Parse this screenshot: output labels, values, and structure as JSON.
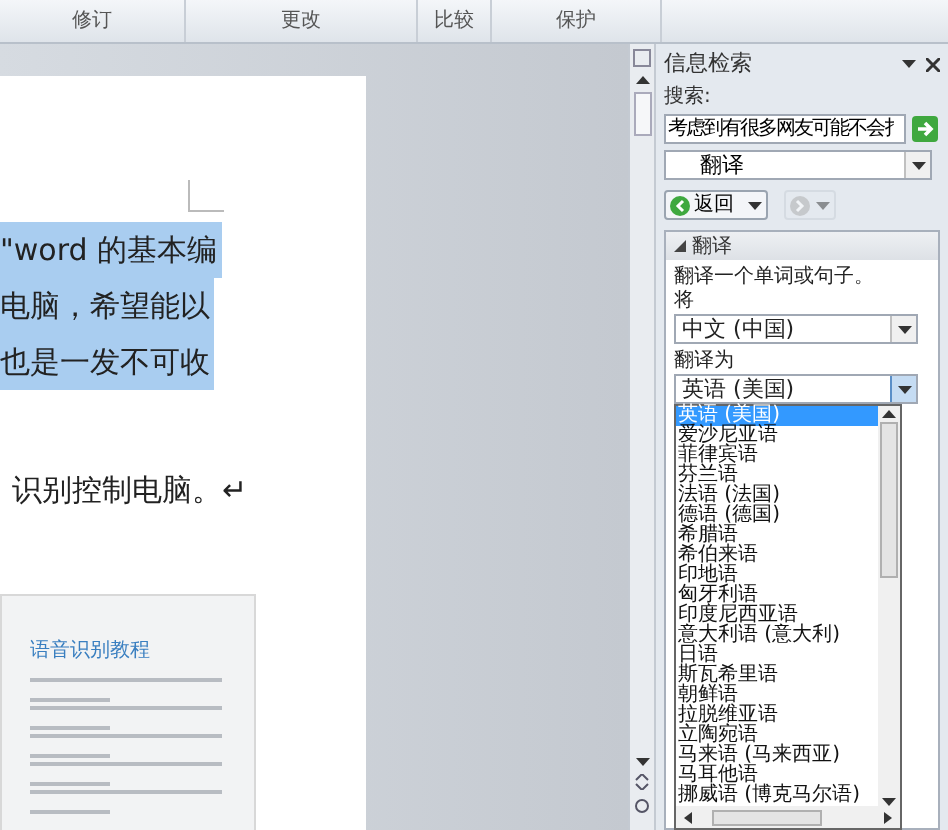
{
  "ribbon_groups": [
    "修订",
    "更改",
    "比较",
    "保护"
  ],
  "document": {
    "paragraphs": [
      {
        "text": "\"word 的基本编",
        "selected": true
      },
      {
        "text": "电脑，希望能以",
        "selected": true
      },
      {
        "text": "也是一发不可收",
        "selected": true
      },
      {
        "text": "识别控制电脑。↵",
        "selected": false
      }
    ],
    "thumbnail": {
      "title": "语音识别教程"
    }
  },
  "pane": {
    "title": "信息检索",
    "search_label": "搜索:",
    "search_value": "考虑到有很多网友可能不会扌",
    "service": "翻译",
    "back_label": "返回",
    "forward_disabled": true,
    "section": {
      "title": "翻译",
      "expanded": true,
      "description": "翻译一个单词或句子。",
      "from_label": "将",
      "from_value": "中文 (中国)",
      "to_label": "翻译为",
      "to_value": "英语 (美国)",
      "to_open": true
    },
    "languages": [
      {
        "label": "英语 (美国)",
        "selected": true
      },
      {
        "label": "爱沙尼亚语",
        "selected": false
      },
      {
        "label": "菲律宾语",
        "selected": false
      },
      {
        "label": "芬兰语",
        "selected": false
      },
      {
        "label": "法语 (法国)",
        "selected": false
      },
      {
        "label": "德语 (德国)",
        "selected": false
      },
      {
        "label": "希腊语",
        "selected": false
      },
      {
        "label": "希伯来语",
        "selected": false
      },
      {
        "label": "印地语",
        "selected": false
      },
      {
        "label": "匈牙利语",
        "selected": false
      },
      {
        "label": "印度尼西亚语",
        "selected": false
      },
      {
        "label": "意大利语 (意大利)",
        "selected": false
      },
      {
        "label": "日语",
        "selected": false
      },
      {
        "label": "斯瓦希里语",
        "selected": false
      },
      {
        "label": "朝鲜语",
        "selected": false
      },
      {
        "label": "拉脱维亚语",
        "selected": false
      },
      {
        "label": "立陶宛语",
        "selected": false
      },
      {
        "label": "马来语 (马来西亚)",
        "selected": false
      },
      {
        "label": "马耳他语",
        "selected": false
      },
      {
        "label": "挪威语 (博克马尔语)",
        "selected": false
      }
    ]
  }
}
